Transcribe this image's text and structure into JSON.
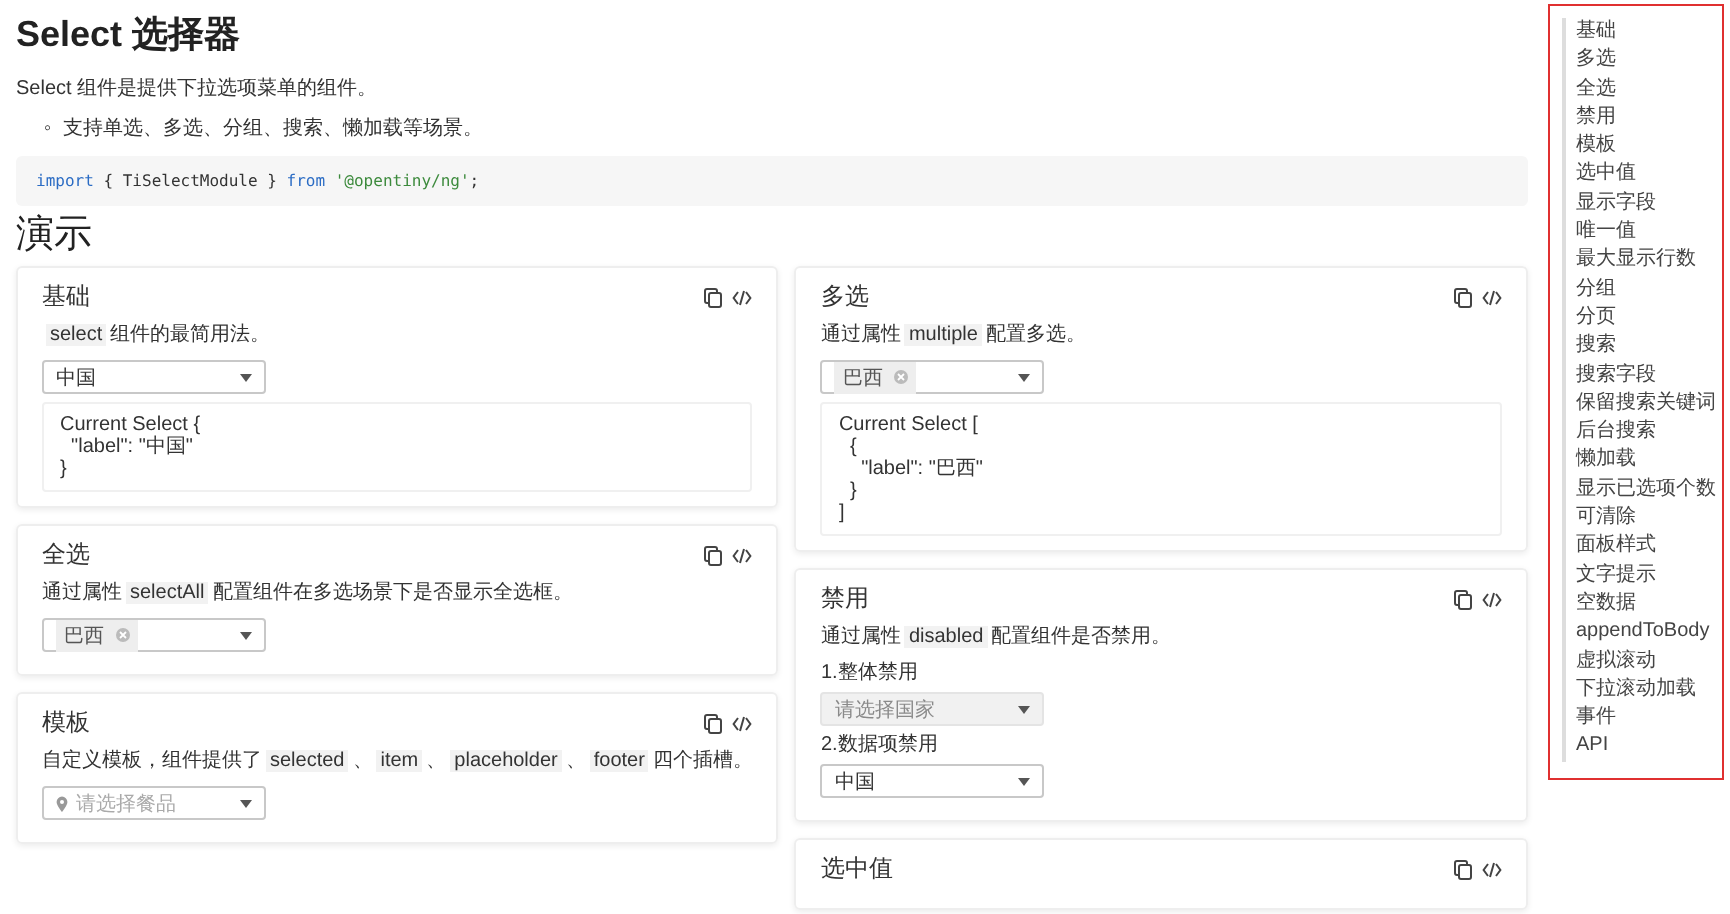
{
  "title": "Select 选择器",
  "intro": "Select 组件是提供下拉选项菜单的组件。",
  "bullets": [
    {
      "marker": "◦",
      "text": "支持单选、多选、分组、搜索、懒加载等场景。"
    }
  ],
  "import_code": [
    {
      "kind": "keyword",
      "text": "import"
    },
    {
      "kind": "plain",
      "text": "{ TiSelectModule }"
    },
    {
      "kind": "keyword",
      "text": "from"
    },
    {
      "kind": "string",
      "text": "'@opentiny/ng'"
    },
    {
      "kind": "plain",
      "text": ";"
    }
  ],
  "demo_heading": "演示",
  "columns": [
    [
      {
        "title": "基础",
        "body": [
          {
            "kind": "desc",
            "parts": [
              {
                "kind": "code",
                "text": "select"
              },
              {
                "kind": "text",
                "text": "组件的最简用法。"
              }
            ]
          },
          {
            "kind": "select",
            "value": "中国",
            "disabled": false
          },
          {
            "kind": "output",
            "text": "Current Select {\n  \"label\": \"中国\"\n}"
          }
        ]
      },
      {
        "title": "全选",
        "body": [
          {
            "kind": "desc",
            "parts": [
              {
                "kind": "text",
                "text": "通过属性"
              },
              {
                "kind": "code",
                "text": "selectAll"
              },
              {
                "kind": "text",
                "text": "配置组件在多选场景下是否显示全选框。"
              }
            ]
          },
          {
            "kind": "multi",
            "tags": [
              "巴西"
            ]
          }
        ]
      },
      {
        "title": "模板",
        "body": [
          {
            "kind": "desc",
            "parts": [
              {
                "kind": "text",
                "text": "自定义模板，组件提供了"
              },
              {
                "kind": "code",
                "text": "selected"
              },
              {
                "kind": "text",
                "text": "、"
              },
              {
                "kind": "code",
                "text": "item"
              },
              {
                "kind": "text",
                "text": "、"
              },
              {
                "kind": "code",
                "text": "placeholder"
              },
              {
                "kind": "text",
                "text": "、"
              },
              {
                "kind": "code",
                "text": "footer"
              },
              {
                "kind": "text",
                "text": "四个插槽。"
              }
            ]
          },
          {
            "kind": "pin-select",
            "placeholder": "请选择餐品"
          }
        ]
      }
    ],
    [
      {
        "title": "多选",
        "body": [
          {
            "kind": "desc",
            "parts": [
              {
                "kind": "text",
                "text": "通过属性"
              },
              {
                "kind": "code",
                "text": "multiple"
              },
              {
                "kind": "text",
                "text": "配置多选。"
              }
            ]
          },
          {
            "kind": "multi",
            "tags": [
              "巴西"
            ]
          },
          {
            "kind": "output",
            "text": "Current Select [\n  {\n    \"label\": \"巴西\"\n  }\n]"
          }
        ]
      },
      {
        "title": "禁用",
        "body": [
          {
            "kind": "desc",
            "parts": [
              {
                "kind": "text",
                "text": "通过属性"
              },
              {
                "kind": "code",
                "text": "disabled"
              },
              {
                "kind": "text",
                "text": "配置组件是否禁用。"
              }
            ]
          },
          {
            "kind": "label",
            "text": "1.整体禁用"
          },
          {
            "kind": "select",
            "placeholder": "请选择国家",
            "disabled": true
          },
          {
            "kind": "label",
            "text": "2.数据项禁用"
          },
          {
            "kind": "select",
            "value": "中国",
            "disabled": false
          }
        ]
      },
      {
        "title": "选中值"
      }
    ]
  ],
  "toc": [
    "基础",
    "多选",
    "全选",
    "禁用",
    "模板",
    "选中值",
    "显示字段",
    "唯一值",
    "最大显示行数",
    "分组",
    "分页",
    "搜索",
    "搜索字段",
    "保留搜索关键词",
    "后台搜索",
    "懒加载",
    "显示已选项个数",
    "可清除",
    "面板样式",
    "文字提示",
    "空数据",
    "appendToBody",
    "虚拟滚动",
    "下拉滚动加载",
    "事件",
    "API"
  ]
}
